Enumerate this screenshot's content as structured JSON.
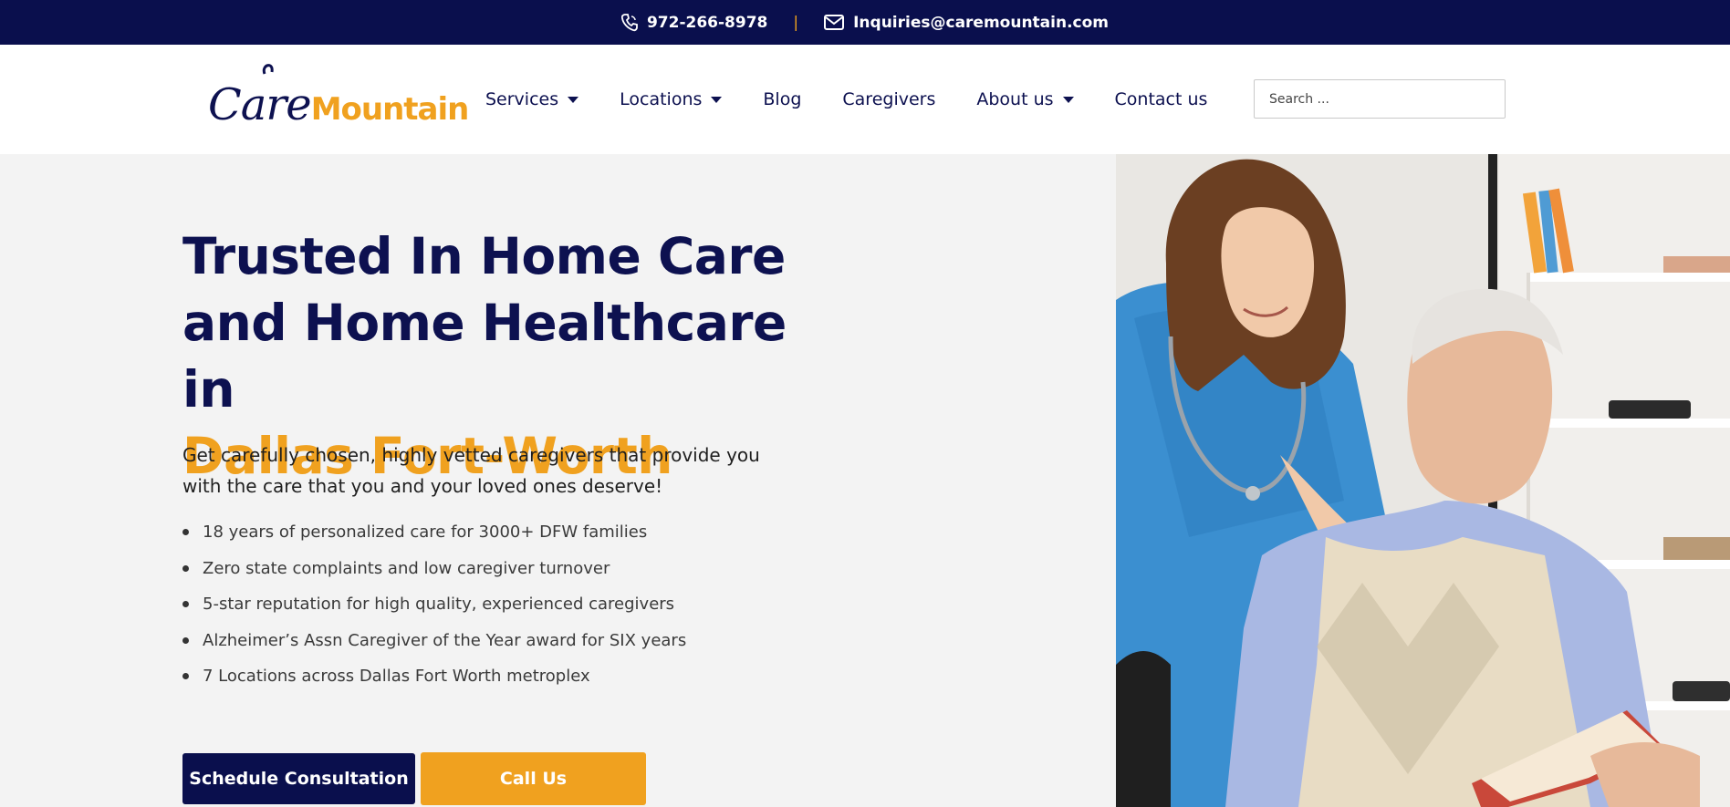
{
  "topbar": {
    "phone": "972-266-8978",
    "separator": "|",
    "email": "Inquiries@caremountain.com"
  },
  "header": {
    "logo": {
      "part1": "Care",
      "part2": "Mountain"
    },
    "nav": [
      {
        "label": "Services",
        "has_dropdown": true
      },
      {
        "label": "Locations",
        "has_dropdown": true
      },
      {
        "label": "Blog",
        "has_dropdown": false
      },
      {
        "label": "Caregivers",
        "has_dropdown": false
      },
      {
        "label": "About us",
        "has_dropdown": true
      },
      {
        "label": "Contact us",
        "has_dropdown": false
      }
    ],
    "search": {
      "placeholder": "Search ...",
      "value": ""
    }
  },
  "hero": {
    "title_line1": "Trusted In Home Care",
    "title_line2": "and Home Healthcare in",
    "title_accent": "Dallas Fort-Worth",
    "subtitle": "Get carefully chosen, highly vetted caregivers that provide you with the care that you and your loved ones deserve!",
    "bullets": [
      "18 years of personalized care for 3000+ DFW families",
      "Zero state complaints and low caregiver turnover",
      "5-star reputation for high quality, experienced caregivers",
      "Alzheimer’s Assn Caregiver of the Year award for SIX years",
      "7 Locations across Dallas Fort Worth metroplex"
    ],
    "cta_primary": "Schedule Consultation",
    "cta_secondary": "Call Us"
  },
  "colors": {
    "navy": "#0a0f4d",
    "orange": "#f0a11f",
    "hero_bg": "#f3f3f3"
  },
  "icons": {
    "phone": "phone-icon",
    "email": "envelope-icon",
    "caret": "caret-down-icon"
  }
}
